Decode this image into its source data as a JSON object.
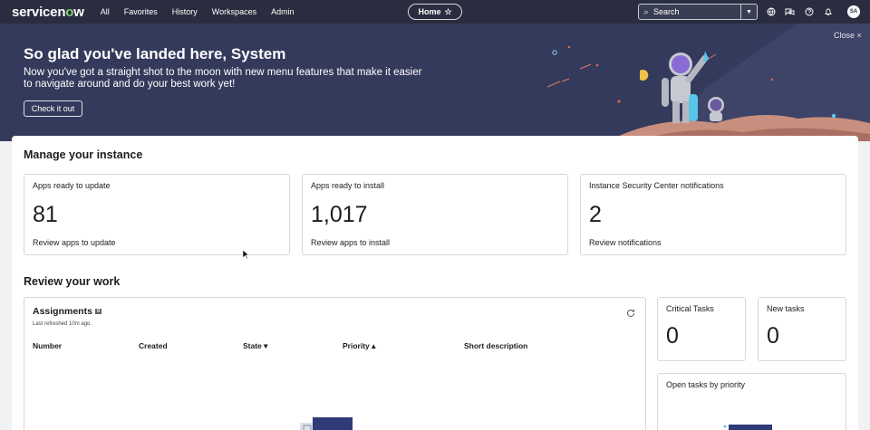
{
  "nav": {
    "brand_prefix": "servicen",
    "brand_o": "o",
    "brand_suffix": "w",
    "links": [
      "All",
      "Favorites",
      "History",
      "Workspaces",
      "Admin"
    ],
    "home_label": "Home",
    "search_placeholder": "Search",
    "avatar_initials": "SA"
  },
  "banner": {
    "title": "So glad you've landed here, System",
    "text": "Now you've got a straight shot to the moon with new menu features that make it easier to navigate around and do your best work yet!",
    "cta_label": "Check it out",
    "close_label": "Close ×"
  },
  "manage": {
    "heading": "Manage your instance",
    "cards": [
      {
        "title": "Apps ready to update",
        "value": "81",
        "link": "Review apps to update"
      },
      {
        "title": "Apps ready to install",
        "value": "1,017",
        "link": "Review apps to install"
      },
      {
        "title": "Instance Security Center notifications",
        "value": "2",
        "link": "Review notifications"
      }
    ]
  },
  "review": {
    "heading": "Review your work",
    "assignments": {
      "title": "Assignments",
      "badge": "0",
      "refreshed": "Last refreshed 10m ago.",
      "columns": [
        "Number",
        "Created",
        "State",
        "Priority",
        "Short description"
      ],
      "state_sort": "▾",
      "priority_sort": "▴"
    },
    "critical": {
      "title": "Critical Tasks",
      "value": "0"
    },
    "new_tasks": {
      "title": "New tasks",
      "value": "0"
    },
    "open_by_priority": {
      "title": "Open tasks by priority"
    }
  },
  "colors": {
    "nav_bg": "#2a2d3f",
    "banner_bg": "#343a5b",
    "accent": "#7fd37a"
  }
}
